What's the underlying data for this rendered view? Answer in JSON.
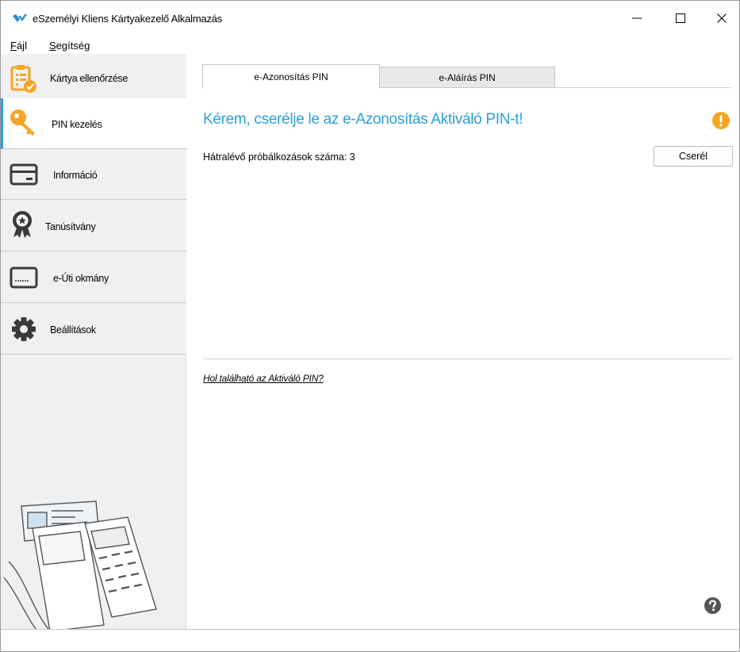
{
  "window": {
    "title": "eSzemélyi Kliens Kártyakezelő Alkalmazás",
    "min_glyph": "—",
    "close_glyph": "✕"
  },
  "menu": {
    "file_first": "F",
    "file_rest": "ájl",
    "help_first": "S",
    "help_rest": "egítség"
  },
  "sidebar": {
    "items": [
      {
        "label": "Kártya ellenőrzése",
        "icon": "card-check-icon"
      },
      {
        "label": "PIN kezelés",
        "icon": "key-icon"
      },
      {
        "label": "Információ",
        "icon": "card-icon"
      },
      {
        "label": "Tanúsítvány",
        "icon": "certificate-icon"
      },
      {
        "label": "e-Úti okmány",
        "icon": "passport-card-icon"
      },
      {
        "label": "Beállítások",
        "icon": "gear-icon"
      }
    ],
    "active_index": 1
  },
  "tabs": [
    {
      "label": "e-Azonosítás PIN",
      "active": true
    },
    {
      "label": "e-Aláírás PIN",
      "active": false
    }
  ],
  "main": {
    "heading": "Kérem, cserélje le az e-Azonosítás Aktiváló PIN-t!",
    "attempts_text": "Hátralévő próbálkozások száma: 3",
    "change_button": "Cserél",
    "pin_link": "Hol található az Aktiváló PIN?"
  },
  "colors": {
    "accent": "#2aa0d8",
    "warning": "#f5a623",
    "sidebar_bg": "#f0f0f0",
    "icon_orange": "#f5a623",
    "icon_dark": "#3a3a3a"
  }
}
